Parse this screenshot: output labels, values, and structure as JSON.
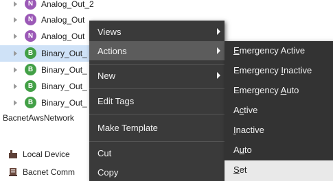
{
  "tree": {
    "rows": [
      {
        "badge": "N",
        "label": "Analog_Out_2"
      },
      {
        "badge": "N",
        "label": "Analog_Out"
      },
      {
        "badge": "N",
        "label": "Analog_Out"
      },
      {
        "badge": "B",
        "label": "Binary_Out_"
      },
      {
        "badge": "B",
        "label": "Binary_Out_"
      },
      {
        "badge": "B",
        "label": "Binary_Out_"
      },
      {
        "badge": "B",
        "label": "Binary_Out_"
      }
    ],
    "network_label": "BacnetAwsNetwork",
    "local_device": "Local Device",
    "bacnet_comm": "Bacnet Comm"
  },
  "context_menu": {
    "items": [
      {
        "label": "Views",
        "has_submenu": true
      },
      {
        "label": "Actions",
        "has_submenu": true
      },
      {
        "label": "New",
        "has_submenu": true
      },
      {
        "label": "Edit Tags",
        "has_submenu": false
      },
      {
        "label": "Make Template",
        "has_submenu": false
      },
      {
        "label": "Cut",
        "has_submenu": false
      },
      {
        "label": "Copy",
        "has_submenu": false
      }
    ]
  },
  "actions_submenu": {
    "items": [
      {
        "pre": "",
        "ul": "E",
        "post": "mergency Active"
      },
      {
        "pre": "Emergency ",
        "ul": "I",
        "post": "nactive"
      },
      {
        "pre": "Emergency ",
        "ul": "A",
        "post": "uto"
      },
      {
        "pre": "A",
        "ul": "c",
        "post": "tive"
      },
      {
        "pre": "",
        "ul": "I",
        "post": "nactive"
      },
      {
        "pre": "A",
        "ul": "u",
        "post": "to"
      },
      {
        "pre": "",
        "ul": "S",
        "post": "et"
      }
    ]
  },
  "colors": {
    "menu_bg": "#3a3a3a",
    "menu_hover": "#5c5c5c",
    "submenu_bg": "#333333",
    "submenu_selected": "#e9e9e9",
    "tree_selected": "#cfe2f7",
    "badge_n": "#9b59b6",
    "badge_b": "#43a047"
  }
}
